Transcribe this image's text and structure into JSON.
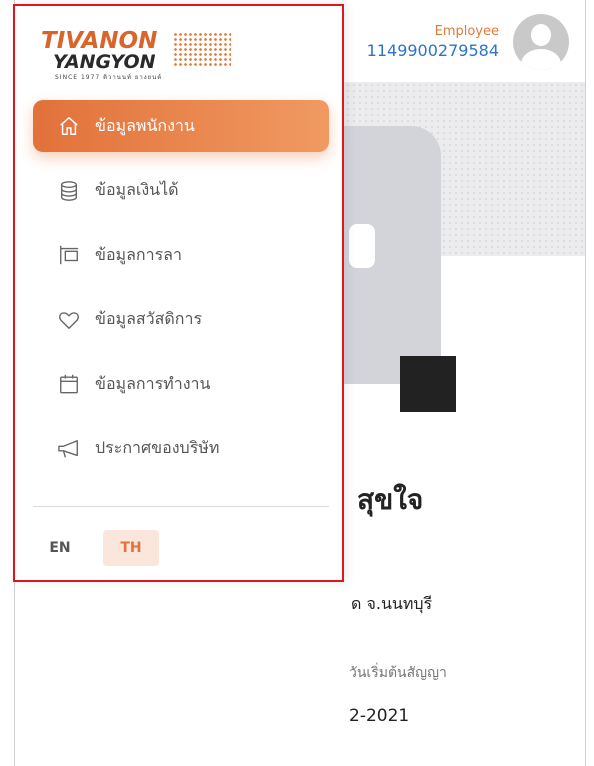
{
  "header": {
    "role_label": "Employee",
    "employee_id": "1149900279584"
  },
  "profile": {
    "name_partial": "สุขใจ",
    "branch_partial": "ด จ.นนทบุรี",
    "contract_start_label_partial": "วันเริ่มต้นสัญญา",
    "contract_start_value_partial": "2-2021"
  },
  "drawer": {
    "logo": {
      "line1": "TIVANON",
      "line2": "YANGYON",
      "tagline": "SINCE 1977  ติวานนท์  ยางยนต์"
    },
    "menu": [
      {
        "label": "ข้อมูลพนักงาน",
        "icon": "home-icon",
        "active": true
      },
      {
        "label": "ข้อมูลเงินได้",
        "icon": "database-icon",
        "active": false
      },
      {
        "label": "ข้อมูลการลา",
        "icon": "sign-icon",
        "active": false
      },
      {
        "label": "ข้อมูลสวัสดิการ",
        "icon": "heart-icon",
        "active": false
      },
      {
        "label": "ข้อมูลการทำงาน",
        "icon": "calendar-icon",
        "active": false
      },
      {
        "label": "ประกาศของบริษัท",
        "icon": "megaphone-icon",
        "active": false
      }
    ],
    "languages": {
      "en": "EN",
      "th": "TH",
      "selected": "TH"
    }
  },
  "colors": {
    "accent": "#e2713a",
    "link": "#2c74c9",
    "highlight_border": "#e0161e"
  }
}
